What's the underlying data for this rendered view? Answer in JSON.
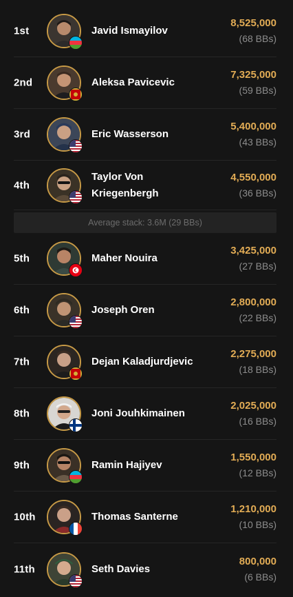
{
  "average_stack": "Average stack: 3.6M (29 BBs)",
  "colors": {
    "accent": "#e2ac55",
    "muted": "#8d8d8d",
    "background": "#151515"
  },
  "players": [
    {
      "rank": "1st",
      "name": "Javid Ismayilov",
      "chips": "8,525,000",
      "bbs": "(68 BBs)",
      "flag": "azerbaijan-flag-icon"
    },
    {
      "rank": "2nd",
      "name": "Aleksa Pavicevic",
      "chips": "7,325,000",
      "bbs": "(59 BBs)",
      "flag": "montenegro-flag-icon"
    },
    {
      "rank": "3rd",
      "name": "Eric Wasserson",
      "chips": "5,400,000",
      "bbs": "(43 BBs)",
      "flag": "usa-flag-icon"
    },
    {
      "rank": "4th",
      "name": "Taylor Von Kriegenbergh",
      "chips": "4,550,000",
      "bbs": "(36 BBs)",
      "flag": "usa-flag-icon"
    },
    {
      "rank": "5th",
      "name": "Maher Nouira",
      "chips": "3,425,000",
      "bbs": "(27 BBs)",
      "flag": "tunisia-flag-icon"
    },
    {
      "rank": "6th",
      "name": "Joseph Oren",
      "chips": "2,800,000",
      "bbs": "(22 BBs)",
      "flag": "usa-flag-icon"
    },
    {
      "rank": "7th",
      "name": "Dejan Kaladjurdjevic",
      "chips": "2,275,000",
      "bbs": "(18 BBs)",
      "flag": "montenegro-flag-icon"
    },
    {
      "rank": "8th",
      "name": "Joni Jouhkimainen",
      "chips": "2,025,000",
      "bbs": "(16 BBs)",
      "flag": "finland-flag-icon"
    },
    {
      "rank": "9th",
      "name": "Ramin Hajiyev",
      "chips": "1,550,000",
      "bbs": "(12 BBs)",
      "flag": "azerbaijan-flag-icon"
    },
    {
      "rank": "10th",
      "name": "Thomas Santerne",
      "chips": "1,210,000",
      "bbs": "(10 BBs)",
      "flag": "france-flag-icon"
    },
    {
      "rank": "11th",
      "name": "Seth Davies",
      "chips": "800,000",
      "bbs": "(6 BBs)",
      "flag": "usa-flag-icon"
    }
  ]
}
